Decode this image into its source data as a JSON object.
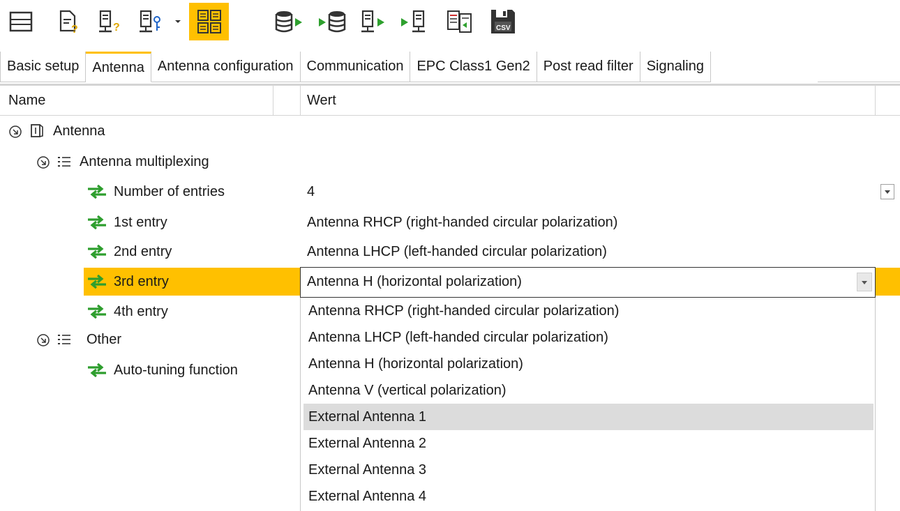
{
  "toolbar": {
    "buttons": [
      {
        "icon": "layout-icon"
      },
      {
        "icon": "document-question-icon"
      },
      {
        "icon": "device-question-icon"
      },
      {
        "icon": "device-key-icon"
      },
      {
        "icon": "dropdown-arrow-icon"
      },
      {
        "icon": "grid-view-icon",
        "active": true
      },
      {
        "icon": "database-export-icon"
      },
      {
        "icon": "database-import-icon"
      },
      {
        "icon": "device-export-icon"
      },
      {
        "icon": "device-import-icon"
      },
      {
        "icon": "compare-icon"
      },
      {
        "icon": "save-csv-icon",
        "text": "CSV"
      }
    ],
    "accent_color": "#ffc000"
  },
  "tabs": [
    {
      "label": "Basic setup"
    },
    {
      "label": "Antenna",
      "active": true
    },
    {
      "label": "Antenna configuration"
    },
    {
      "label": "Communication"
    },
    {
      "label": "EPC Class1 Gen2"
    },
    {
      "label": "Post read filter"
    },
    {
      "label": "Signaling"
    }
  ],
  "grid": {
    "col_name": "Name",
    "col_value": "Wert"
  },
  "tree": {
    "antenna": "Antenna",
    "multiplexing": "Antenna multiplexing",
    "number_of_entries": {
      "label": "Number of entries",
      "value": "4"
    },
    "entry1": {
      "label": "1st entry",
      "value": "Antenna RHCP (right-handed circular polarization)"
    },
    "entry2": {
      "label": "2nd entry",
      "value": "Antenna LHCP (left-handed circular polarization)"
    },
    "entry3": {
      "label": "3rd entry",
      "value": "Antenna H (horizontal polarization)"
    },
    "entry4": {
      "label": "4th entry"
    },
    "other": "Other",
    "auto_tuning": "Auto-tuning function"
  },
  "dropdown": {
    "options": [
      "Antenna RHCP (right-handed circular polarization)",
      "Antenna LHCP (left-handed circular polarization)",
      "Antenna H (horizontal polarization)",
      "Antenna V (vertical polarization)",
      "External Antenna 1",
      "External Antenna 2",
      "External Antenna 3",
      "External Antenna 4"
    ],
    "highlighted": "External Antenna 1"
  }
}
